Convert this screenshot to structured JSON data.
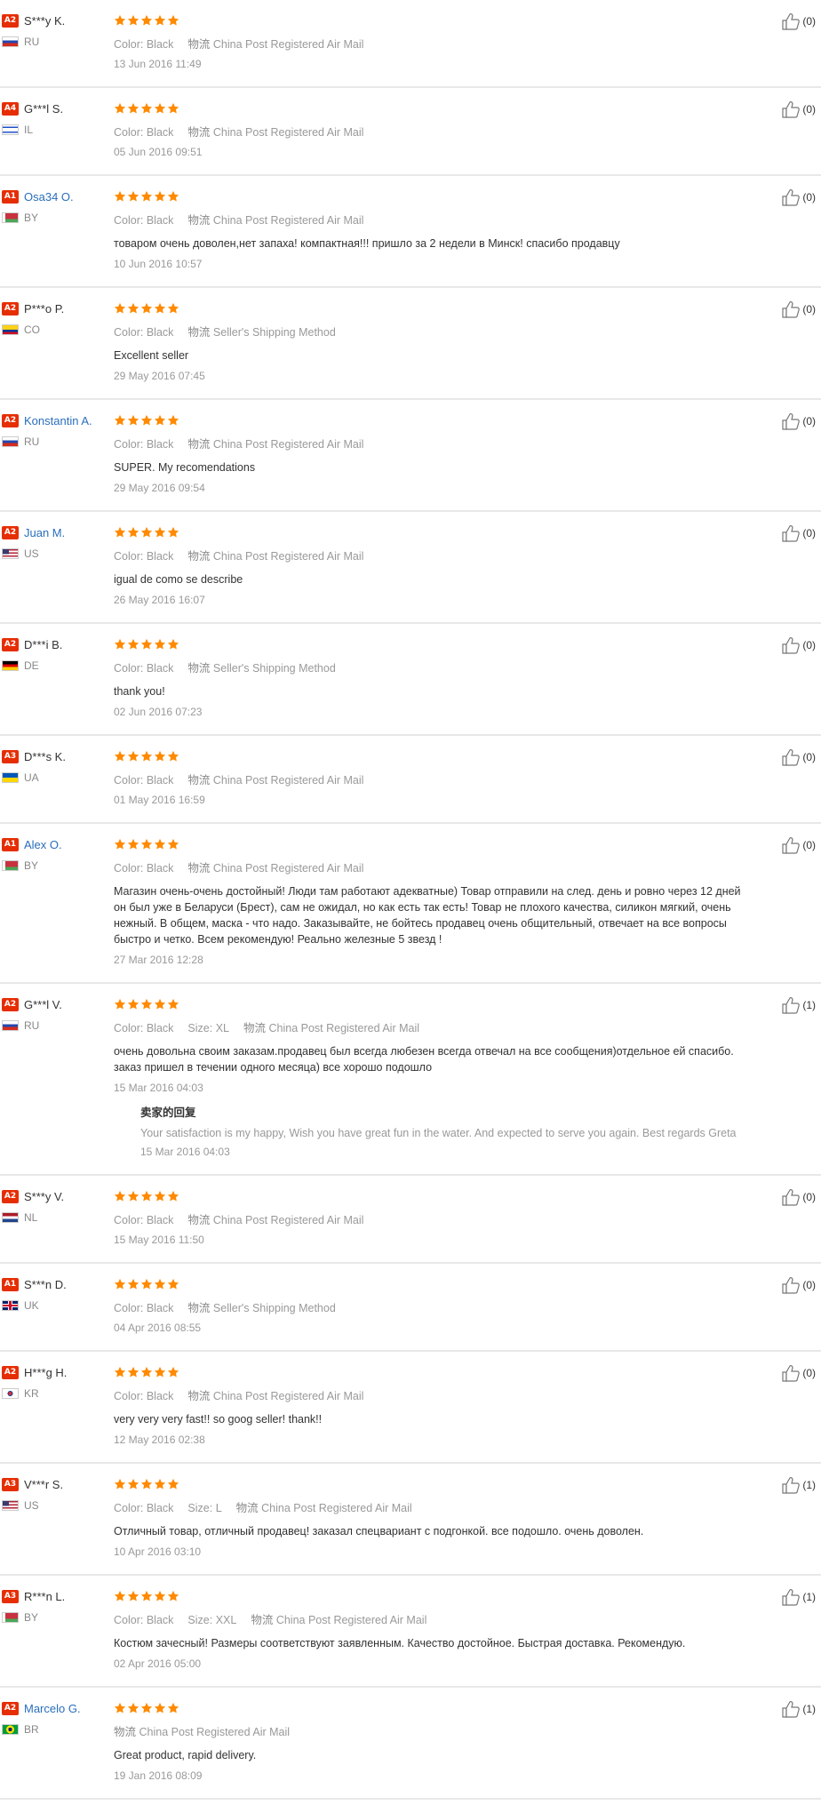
{
  "labels": {
    "color": "Color:",
    "size": "Size:",
    "logistics": "物流",
    "reply_title": "卖家的回复"
  },
  "reviews": [
    {
      "level": "A2",
      "name": "S***y K.",
      "link": false,
      "country": "RU",
      "flag": "ru",
      "color": "Black",
      "shipping": "China Post Registered Air Mail",
      "text": "",
      "date": "13 Jun 2016 11:49",
      "helpful": "(0)"
    },
    {
      "level": "A4",
      "name": "G***l S.",
      "link": false,
      "country": "IL",
      "flag": "il",
      "color": "Black",
      "shipping": "China Post Registered Air Mail",
      "text": "",
      "date": "05 Jun 2016 09:51",
      "helpful": "(0)"
    },
    {
      "level": "A1",
      "name": "Osa34 O.",
      "link": true,
      "country": "BY",
      "flag": "by",
      "color": "Black",
      "shipping": "China Post Registered Air Mail",
      "text": "товаром очень доволен,нет запаха! компактная!!! пришло за 2 недели в Минск! спасибо продавцу",
      "date": "10 Jun 2016 10:57",
      "helpful": "(0)"
    },
    {
      "level": "A2",
      "name": "P***o P.",
      "link": false,
      "country": "CO",
      "flag": "co",
      "color": "Black",
      "shipping": "Seller's Shipping Method",
      "text": "Excellent seller",
      "date": "29 May 2016 07:45",
      "helpful": "(0)"
    },
    {
      "level": "A2",
      "name": "Konstantin A.",
      "link": true,
      "country": "RU",
      "flag": "ru",
      "color": "Black",
      "shipping": "China Post Registered Air Mail",
      "text": "SUPER. My recomendations",
      "date": "29 May 2016 09:54",
      "helpful": "(0)"
    },
    {
      "level": "A2",
      "name": "Juan M.",
      "link": true,
      "country": "US",
      "flag": "us",
      "color": "Black",
      "shipping": "China Post Registered Air Mail",
      "text": "igual de como se describe",
      "date": "26 May 2016 16:07",
      "helpful": "(0)"
    },
    {
      "level": "A2",
      "name": "D***i B.",
      "link": false,
      "country": "DE",
      "flag": "de",
      "color": "Black",
      "shipping": "Seller's Shipping Method",
      "text": "thank you!",
      "date": "02 Jun 2016 07:23",
      "helpful": "(0)"
    },
    {
      "level": "A3",
      "name": "D***s K.",
      "link": false,
      "country": "UA",
      "flag": "ua",
      "color": "Black",
      "shipping": "China Post Registered Air Mail",
      "text": "",
      "date": "01 May 2016 16:59",
      "helpful": "(0)"
    },
    {
      "level": "A1",
      "name": "Alex O.",
      "link": true,
      "country": "BY",
      "flag": "by",
      "color": "Black",
      "shipping": "China Post Registered Air Mail",
      "text": "Магазин очень-очень достойный! Люди там работают адекватные) Товар отправили на след. день и ровно через 12 дней он был уже в Беларуси (Брест), сам не ожидал, но как есть так есть! Товар не плохого качества, силикон мягкий, очень нежный. В общем, маска - что надо. Заказывайте, не бойтесь продавец очень общительный, отвечает на все вопросы быстро и четко. Всем рекомендую! Реально железные 5 звезд !",
      "date": "27 Mar 2016 12:28",
      "helpful": "(0)"
    },
    {
      "level": "A2",
      "name": "G***l V.",
      "link": false,
      "country": "RU",
      "flag": "ru",
      "color": "Black",
      "size": "XL",
      "shipping": "China Post Registered Air Mail",
      "text": "очень довольна своим заказам.продавец был всегда любезен всегда отвечал на все сообщения)отдельное ей спасибо. заказ пришел в течении одного месяца) все хорошо подошло",
      "date": "15 Mar 2016 04:03",
      "helpful": "(1)",
      "reply": {
        "text": "Your satisfaction is my happy, Wish you have great fun in the water. And expected to serve you again. Best regards Greta",
        "date": "15 Mar 2016 04:03"
      }
    },
    {
      "level": "A2",
      "name": "S***y V.",
      "link": false,
      "country": "NL",
      "flag": "nl",
      "color": "Black",
      "shipping": "China Post Registered Air Mail",
      "text": "",
      "date": "15 May 2016 11:50",
      "helpful": "(0)"
    },
    {
      "level": "A1",
      "name": "S***n D.",
      "link": false,
      "country": "UK",
      "flag": "uk",
      "color": "Black",
      "shipping": "Seller's Shipping Method",
      "text": "",
      "date": "04 Apr 2016 08:55",
      "helpful": "(0)"
    },
    {
      "level": "A2",
      "name": "H***g H.",
      "link": false,
      "country": "KR",
      "flag": "kr",
      "color": "Black",
      "shipping": "China Post Registered Air Mail",
      "text": "very very very fast!! so goog seller! thank!!",
      "date": "12 May 2016 02:38",
      "helpful": "(0)"
    },
    {
      "level": "A3",
      "name": "V***r S.",
      "link": false,
      "country": "US",
      "flag": "us",
      "color": "Black",
      "size": "L",
      "shipping": "China Post Registered Air Mail",
      "text": "Отличный товар, отличный продавец! заказал спецвариант с подгонкой. все подошло. очень доволен.",
      "date": "10 Apr 2016 03:10",
      "helpful": "(1)"
    },
    {
      "level": "A3",
      "name": "R***n L.",
      "link": false,
      "country": "BY",
      "flag": "by",
      "color": "Black",
      "size": "XXL",
      "shipping": "China Post Registered Air Mail",
      "text": "Костюм зачесный! Размеры соответствуют заявленным. Качество достойное. Быстрая доставка. Рекомендую.",
      "date": "02 Apr 2016 05:00",
      "helpful": "(1)"
    },
    {
      "level": "A2",
      "name": "Marcelo G.",
      "link": true,
      "country": "BR",
      "flag": "br",
      "shipping": "China Post Registered Air Mail",
      "text": "Great product, rapid delivery.",
      "date": "19 Jan 2016 08:09",
      "helpful": "(1)"
    }
  ],
  "stars_per_review": 5,
  "colors": {
    "star": "#ff8a00",
    "badge": "#e62e04",
    "link": "#2a6ebb"
  }
}
